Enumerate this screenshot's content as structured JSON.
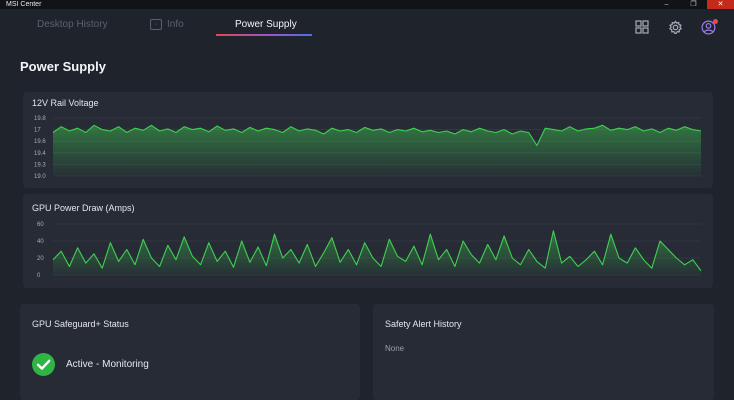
{
  "window": {
    "title": "MSI Center",
    "controls": [
      "–",
      "❐",
      "✕"
    ]
  },
  "tabs": [
    {
      "label": "Desktop History",
      "active": false
    },
    {
      "label": "Info",
      "active": false
    },
    {
      "label": "Power Supply",
      "active": true
    }
  ],
  "header_icons": [
    "grid-icon",
    "gear-icon",
    "user-icon"
  ],
  "page": {
    "title": "Power Supply"
  },
  "colors": {
    "accent_green": "#3fd14f",
    "background": "#1f232c",
    "panel": "#262b35",
    "alert": "#ef4444"
  },
  "voltage_panel": {
    "title": "12V Rail Voltage"
  },
  "amps_panel": {
    "title": "GPU Power Draw (Amps)"
  },
  "safeguard_panel": {
    "title": "GPU Safeguard+ Status",
    "status": "Active - Monitoring"
  },
  "alert_panel": {
    "title": "Safety Alert History",
    "value": "None"
  },
  "chart_data": [
    {
      "type": "area",
      "title": "12V Rail Voltage",
      "yticks": [
        "19.8",
        "17",
        "19.6",
        "19.4",
        "19.3",
        "19.0"
      ],
      "grid": true,
      "series": [
        {
          "values": [
            19.6,
            19.68,
            19.62,
            19.66,
            19.6,
            19.7,
            19.64,
            19.62,
            19.68,
            19.6,
            19.66,
            19.63,
            19.7,
            19.62,
            19.65,
            19.6,
            19.68,
            19.64,
            19.66,
            19.61,
            19.69,
            19.63,
            19.65,
            19.6,
            19.67,
            19.62,
            19.66,
            19.64,
            19.6,
            19.68,
            19.62,
            19.65,
            19.63,
            19.58,
            19.66,
            19.62,
            19.64,
            19.6,
            19.67,
            19.63,
            19.65,
            19.6,
            19.64,
            19.62,
            19.66,
            19.61,
            19.63,
            19.6,
            19.62,
            19.58,
            19.64,
            19.61,
            19.66,
            19.62,
            19.6,
            19.64,
            19.58,
            19.62,
            19.6,
            19.42,
            19.66,
            19.64,
            19.62,
            19.68,
            19.62,
            19.65,
            19.66,
            19.7,
            19.63,
            19.66,
            19.64,
            19.68,
            19.62,
            19.65,
            19.6,
            19.66,
            19.63,
            19.68,
            19.64,
            19.62
          ]
        }
      ]
    },
    {
      "type": "area",
      "title": "GPU Power Draw (Amps)",
      "yticks": [
        "60",
        "40",
        "20",
        "0"
      ],
      "ylim": [
        0,
        60
      ],
      "grid": true,
      "series": [
        {
          "values": [
            18,
            28,
            10,
            32,
            14,
            25,
            8,
            38,
            16,
            30,
            12,
            42,
            20,
            10,
            35,
            18,
            45,
            22,
            12,
            38,
            16,
            28,
            9,
            40,
            15,
            33,
            11,
            48,
            20,
            30,
            14,
            36,
            10,
            26,
            44,
            15,
            30,
            12,
            38,
            20,
            10,
            42,
            22,
            16,
            34,
            12,
            48,
            18,
            30,
            10,
            40,
            24,
            14,
            36,
            18,
            46,
            20,
            12,
            30,
            16,
            8,
            52,
            14,
            22,
            10,
            18,
            28,
            12,
            48,
            20,
            14,
            32,
            18,
            8,
            40,
            30,
            20,
            12,
            18,
            5
          ]
        }
      ]
    }
  ]
}
